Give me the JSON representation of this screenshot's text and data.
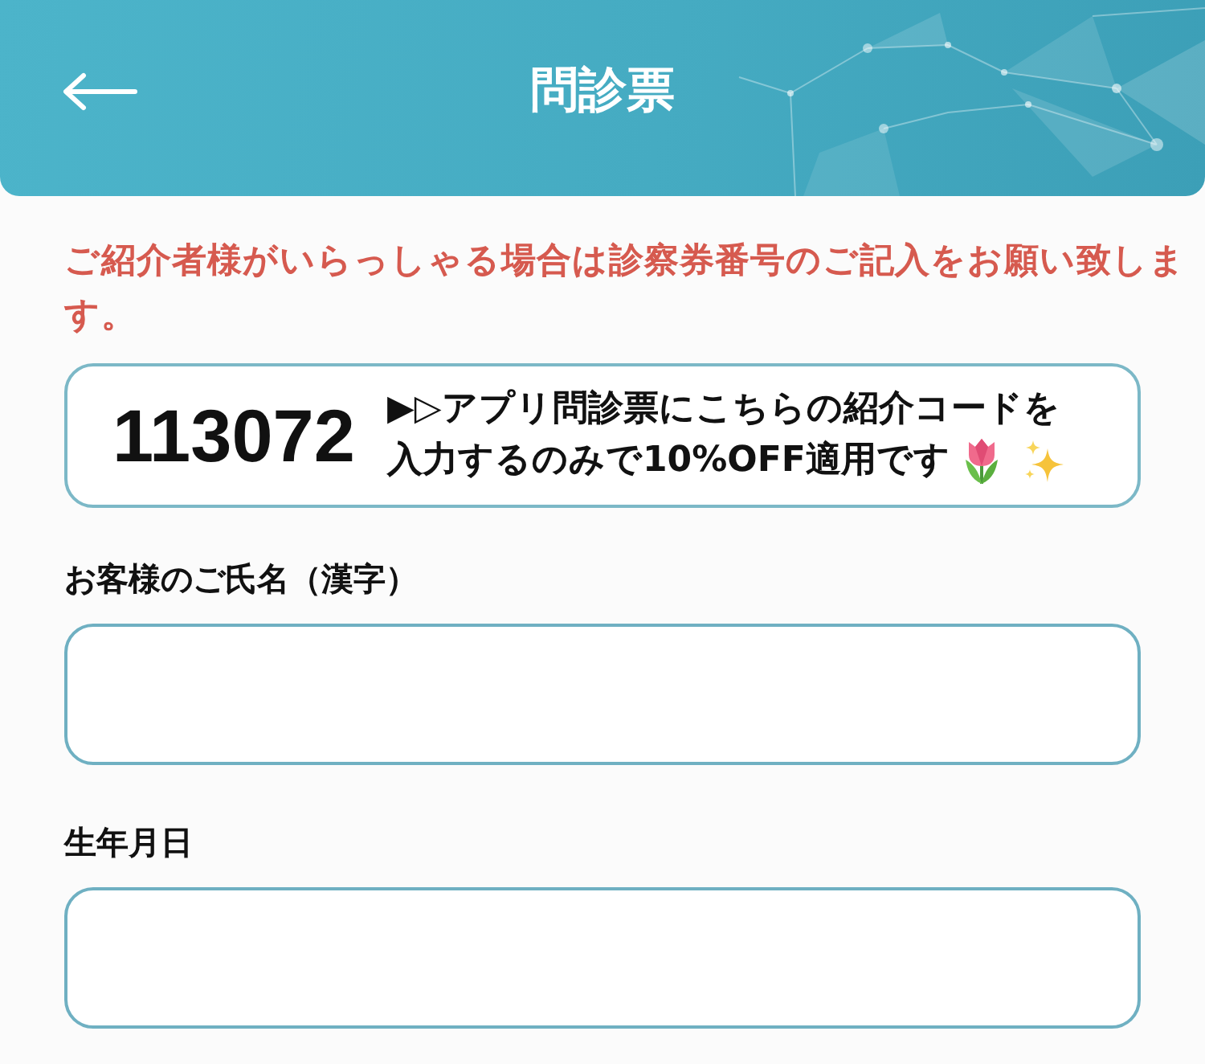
{
  "header": {
    "title": "問診票"
  },
  "notice": "ご紹介者様がいらっしゃる場合は診察券番号のご記入をお願い致します。",
  "referral": {
    "code": "113072",
    "message_lines": [
      "▶▷アプリ問診票にこちらの紹介コードを",
      "入力するのみで10%OFF適用です"
    ]
  },
  "fields": [
    {
      "label": "お客様のご氏名（漢字）"
    },
    {
      "label": "生年月日"
    }
  ]
}
